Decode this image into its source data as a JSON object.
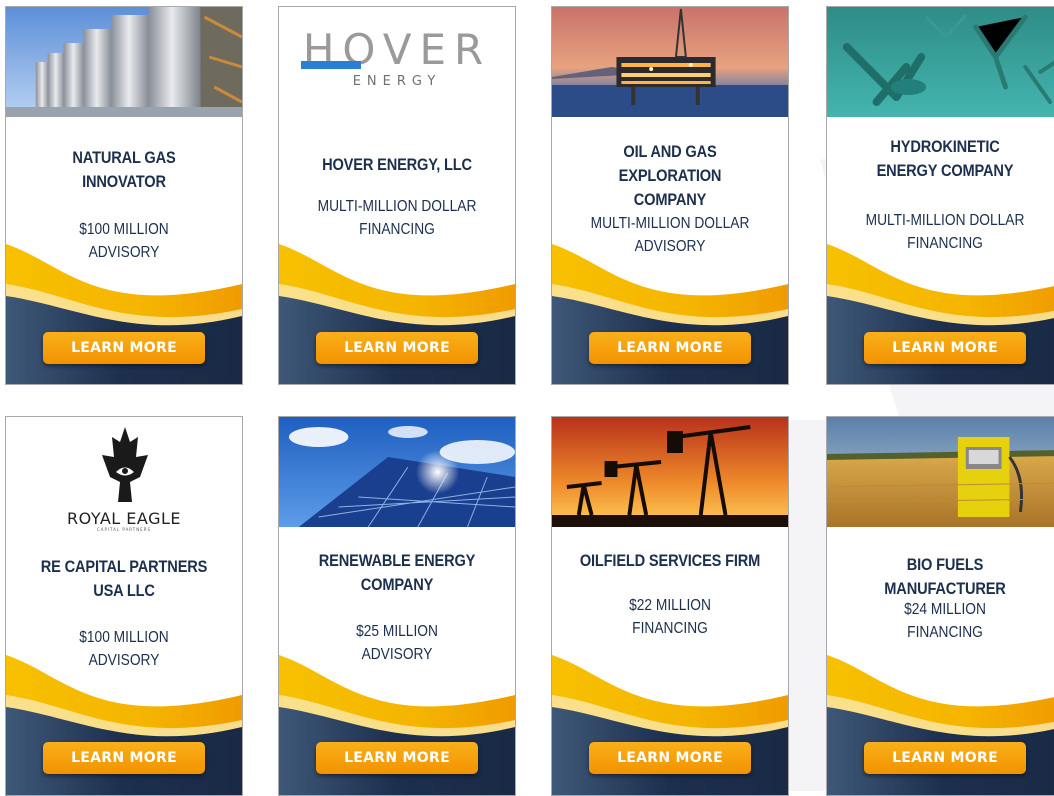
{
  "colors": {
    "navy": "#1c2f4d",
    "orange": "#f39200",
    "yellow": "#f7c100",
    "border": "#a9a9a9"
  },
  "cards": [
    {
      "title": "NATURAL GAS\nINNOVATOR",
      "detail": "$100 MILLION\nADVISORY",
      "button": "LEARN MORE",
      "image": "gas-storage-tanks-photo"
    },
    {
      "title": "HOVER ENERGY, LLC",
      "detail": "MULTI-MILLION DOLLAR\nFINANCING",
      "button": "LEARN MORE",
      "logo_text": "HOVER",
      "logo_sub": "ENERGY"
    },
    {
      "title": "OIL AND GAS EXPLORATION\nCOMPANY",
      "detail": "MULTI-MILLION DOLLAR\nADVISORY",
      "button": "LEARN MORE",
      "image": "offshore-oil-platform-photo"
    },
    {
      "title": "HYDROKINETIC\nENERGY COMPANY",
      "detail": "MULTI-MILLION DOLLAR\nFINANCING",
      "button": "LEARN MORE",
      "image": "underwater-turbines-photo"
    },
    {
      "title": "RE CAPITAL PARTNERS\nUSA LLC",
      "detail": "$100 MILLION\nADVISORY",
      "button": "LEARN MORE",
      "logo_text": "ROYAL EAGLE",
      "logo_sub": "CAPITAL PARTNERS"
    },
    {
      "title": "RENEWABLE ENERGY\nCOMPANY",
      "detail": "$25 MILLION\nADVISORY",
      "button": "LEARN MORE",
      "image": "solar-panels-photo"
    },
    {
      "title": "OILFIELD SERVICES FIRM",
      "detail": "$22 MILLION\nFINANCING",
      "button": "LEARN MORE",
      "image": "oil-pumpjacks-sunset-photo"
    },
    {
      "title": "BIO FUELS MANUFACTURER",
      "detail": "$24 MILLION\nFINANCING",
      "button": "LEARN MORE",
      "image": "wheat-field-fuel-pump-photo"
    }
  ]
}
